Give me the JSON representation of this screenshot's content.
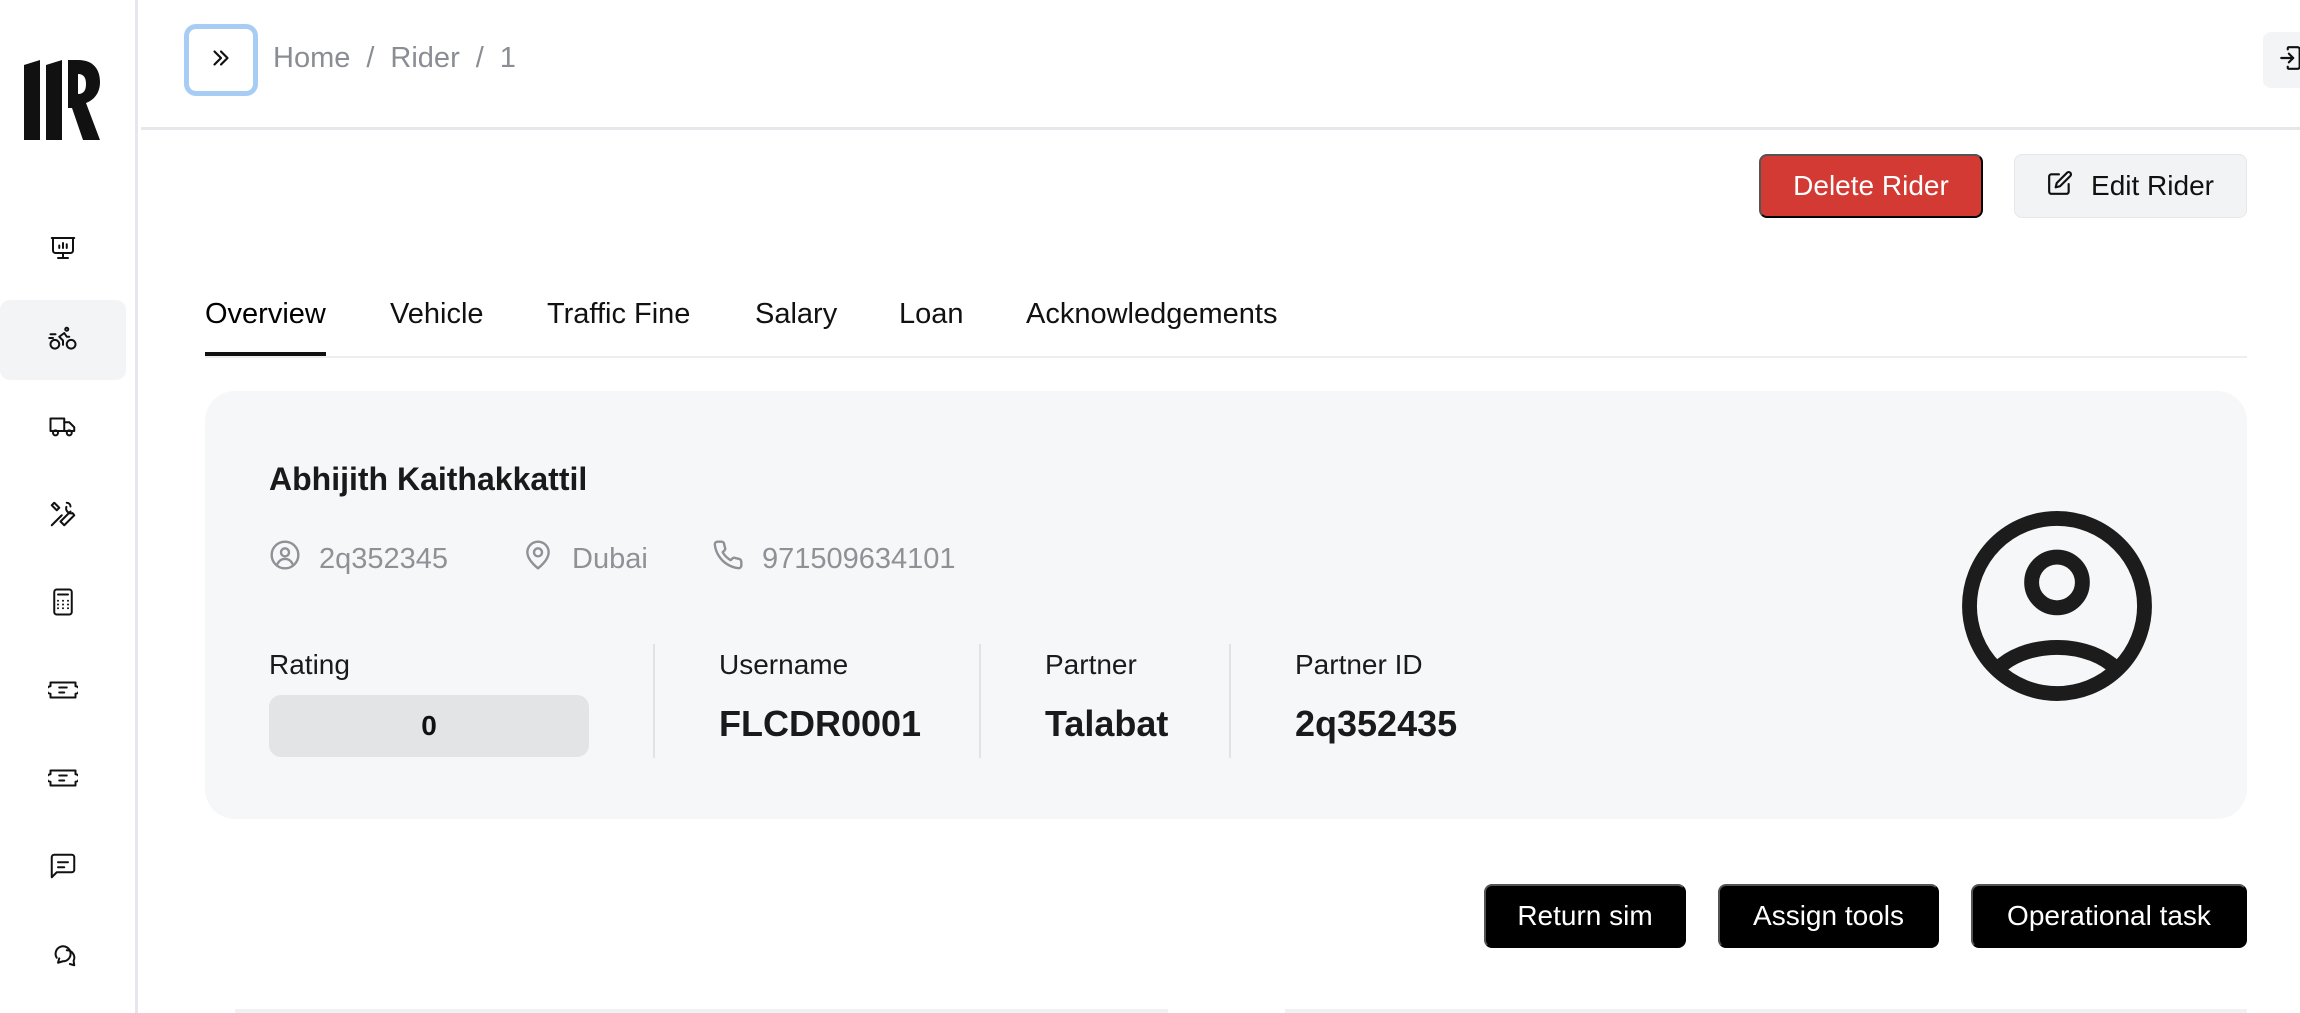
{
  "breadcrumb": {
    "items": [
      "Home",
      "Rider",
      "1"
    ],
    "separator": "/"
  },
  "actions": {
    "delete_label": "Delete Rider",
    "edit_label": "Edit Rider",
    "return_sim_label": "Return sim",
    "assign_tools_label": "Assign tools",
    "operational_task_label": "Operational task"
  },
  "tabs": [
    {
      "label": "Overview",
      "active": true
    },
    {
      "label": "Vehicle",
      "active": false
    },
    {
      "label": "Traffic Fine",
      "active": false
    },
    {
      "label": "Salary",
      "active": false
    },
    {
      "label": "Loan",
      "active": false
    },
    {
      "label": "Acknowledgements",
      "active": false
    }
  ],
  "rider": {
    "name": "Abhijith Kaithakkattil",
    "id": "2q352345",
    "location": "Dubai",
    "phone": "971509634101",
    "rating_label": "Rating",
    "rating_value": "0",
    "username_label": "Username",
    "username_value": "FLCDR0001",
    "partner_label": "Partner",
    "partner_value": "Talabat",
    "partner_id_label": "Partner ID",
    "partner_id_value": "2q352435"
  },
  "sidebar": {
    "items": [
      {
        "icon": "presentation-chart-icon",
        "active": false
      },
      {
        "icon": "bike-rider-icon",
        "active": true
      },
      {
        "icon": "truck-icon",
        "active": false
      },
      {
        "icon": "tools-icon",
        "active": false
      },
      {
        "icon": "calculator-icon",
        "active": false
      },
      {
        "icon": "ticket-icon",
        "active": false
      },
      {
        "icon": "ticket-icon",
        "active": false
      },
      {
        "icon": "message-square-icon",
        "active": false
      },
      {
        "icon": "messages-icon",
        "active": false
      }
    ]
  },
  "colors": {
    "danger": "#d23a33",
    "focus_ring": "#a8cdf5",
    "dark_button": "#000000",
    "card_bg": "#f6f7f8"
  }
}
